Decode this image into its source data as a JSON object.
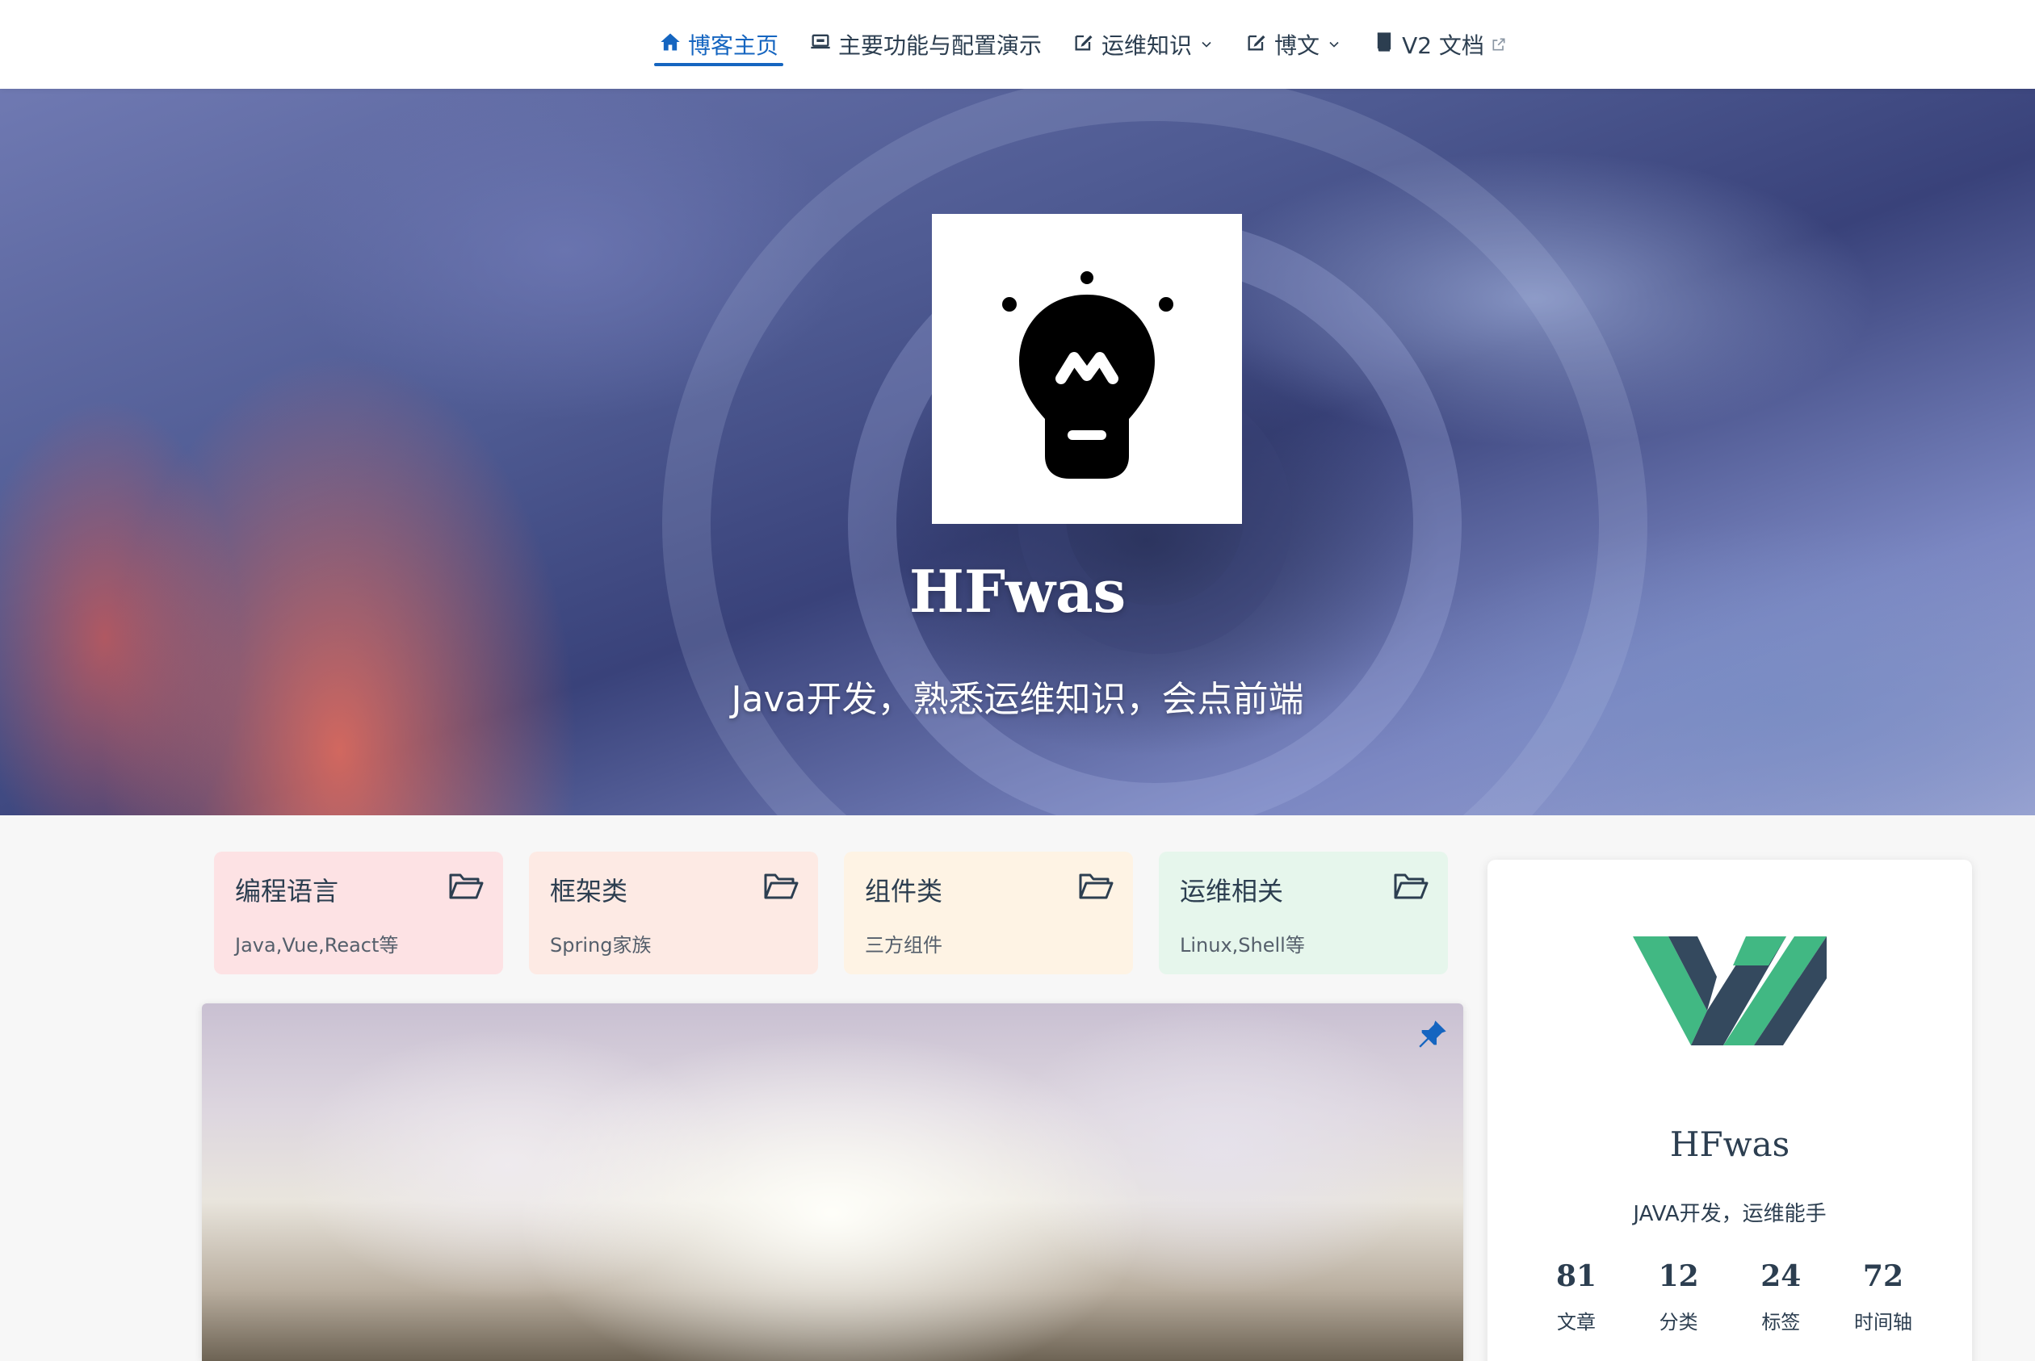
{
  "nav": {
    "items": [
      {
        "label": "博客主页",
        "icon": "home-icon"
      },
      {
        "label": "主要功能与配置演示",
        "icon": "laptop-icon"
      },
      {
        "label": "运维知识",
        "icon": "edit-icon"
      },
      {
        "label": "博文",
        "icon": "edit-icon"
      },
      {
        "label": "V2 文档",
        "icon": "book-icon"
      }
    ]
  },
  "hero": {
    "title": "HFwas",
    "subtitle": "Java开发，熟悉运维知识，会点前端"
  },
  "categories": [
    {
      "title": "编程语言",
      "desc": "Java,Vue,React等",
      "color": "#fde2e4"
    },
    {
      "title": "框架类",
      "desc": "Spring家族",
      "color": "#fdeae4"
    },
    {
      "title": "组件类",
      "desc": "三方组件",
      "color": "#fef3e4"
    },
    {
      "title": "运维相关",
      "desc": "Linux,Shell等",
      "color": "#e6f6ec"
    }
  ],
  "profile": {
    "name": "HFwas",
    "desc": "JAVA开发，运维能手",
    "stats": [
      {
        "num": "81",
        "label": "文章"
      },
      {
        "num": "12",
        "label": "分类"
      },
      {
        "num": "24",
        "label": "标签"
      },
      {
        "num": "72",
        "label": "时间轴"
      }
    ]
  },
  "colors": {
    "accent": "#1565c0",
    "text": "#2c3e50",
    "logo_green": "#41b883",
    "logo_dark": "#34495e"
  }
}
